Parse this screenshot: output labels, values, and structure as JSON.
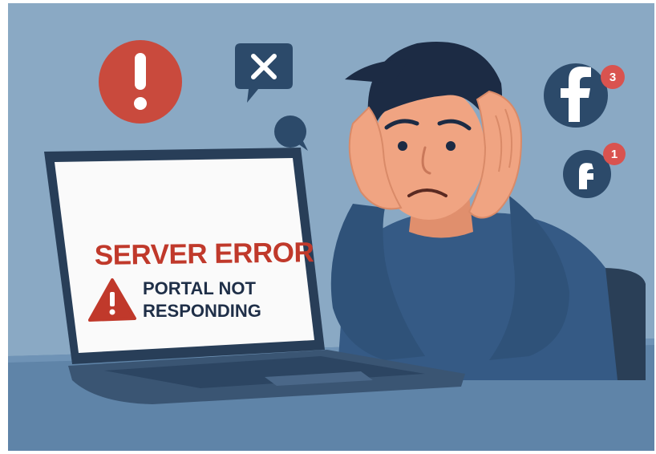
{
  "scene": {
    "error_title": "SERVER ERROR",
    "error_line1": "PORTAL NOT",
    "error_line2": "RESPONDING",
    "notification_top_count": "3",
    "notification_bottom_count": "1"
  },
  "colors": {
    "background": "#8aa9c4",
    "desk": "#5f84a8",
    "laptop_body": "#283e58",
    "screen": "#fafafa",
    "error_red": "#c0392b",
    "sweater": "#355a85",
    "skin": "#f0a482",
    "hair": "#1c2b44",
    "icon_navy": "#2c4a6a",
    "badge_red": "#d9534f"
  }
}
